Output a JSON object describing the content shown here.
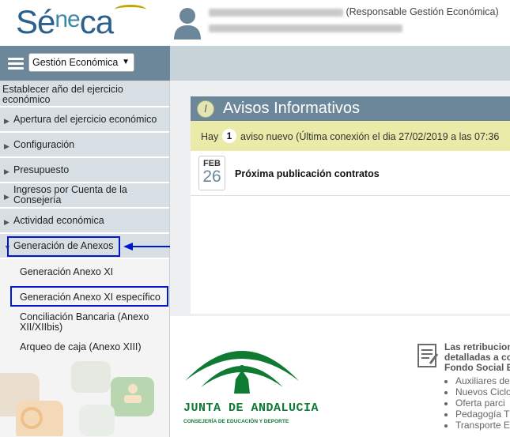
{
  "header": {
    "logo": {
      "pre": "Sé",
      "mid": "ne",
      "post": "ca"
    },
    "user_role": "(Responsable Gestión Económica)"
  },
  "sidebar": {
    "module_select": "Gestión Económica",
    "items": [
      {
        "label": "Establecer año del ejercicio económico"
      },
      {
        "label": "Apertura del ejercicio económico"
      },
      {
        "label": "Configuración"
      },
      {
        "label": "Presupuesto"
      },
      {
        "label": "Ingresos por Cuenta de la Consejería"
      },
      {
        "label": "Actividad económica"
      },
      {
        "label": "Generación de Anexos"
      }
    ],
    "subitems": [
      {
        "label": "Generación Anexo XI"
      },
      {
        "label": "Generación Anexo XI específico"
      },
      {
        "label": "Conciliación Bancaria (Anexo XII/XIIbis)"
      },
      {
        "label": "Arqueo de caja (Anexo XIII)"
      }
    ]
  },
  "avisos": {
    "title": "Avisos Informativos",
    "notice_pre": "Hay",
    "notice_count": "1",
    "notice_post": "aviso nuevo (Última conexión el dia 27/02/2019 a las 07:36",
    "items": [
      {
        "month": "FEB",
        "day": "26",
        "title": "Próxima publicación contratos"
      }
    ]
  },
  "footer": {
    "junta_title": "JUNTA DE ANDALUCIA",
    "junta_subtitle": "CONSEJERÍA DE EDUCACIÓN Y DEPORTE",
    "retrib_lines": [
      "Las retribucion",
      "detalladas a co",
      "Fondo Social E"
    ],
    "retrib_list": [
      "Auxiliares de",
      "Nuevos Ciclo",
      "Oferta parci",
      "Pedagogía T",
      "Transporte E"
    ]
  },
  "colors": {
    "sidebar_header": "#6b8799",
    "menu_item": "#d7dfe4",
    "highlight": "#0018c8",
    "notice_bg": "#eaeaa9",
    "junta_green": "#0e7a32"
  },
  "icons": [
    "user-avatar-icon",
    "hamburger-icon",
    "chevron-down-icon",
    "triangle-right-icon",
    "triangle-down-icon",
    "info-icon",
    "calendar-icon",
    "document-icon"
  ]
}
